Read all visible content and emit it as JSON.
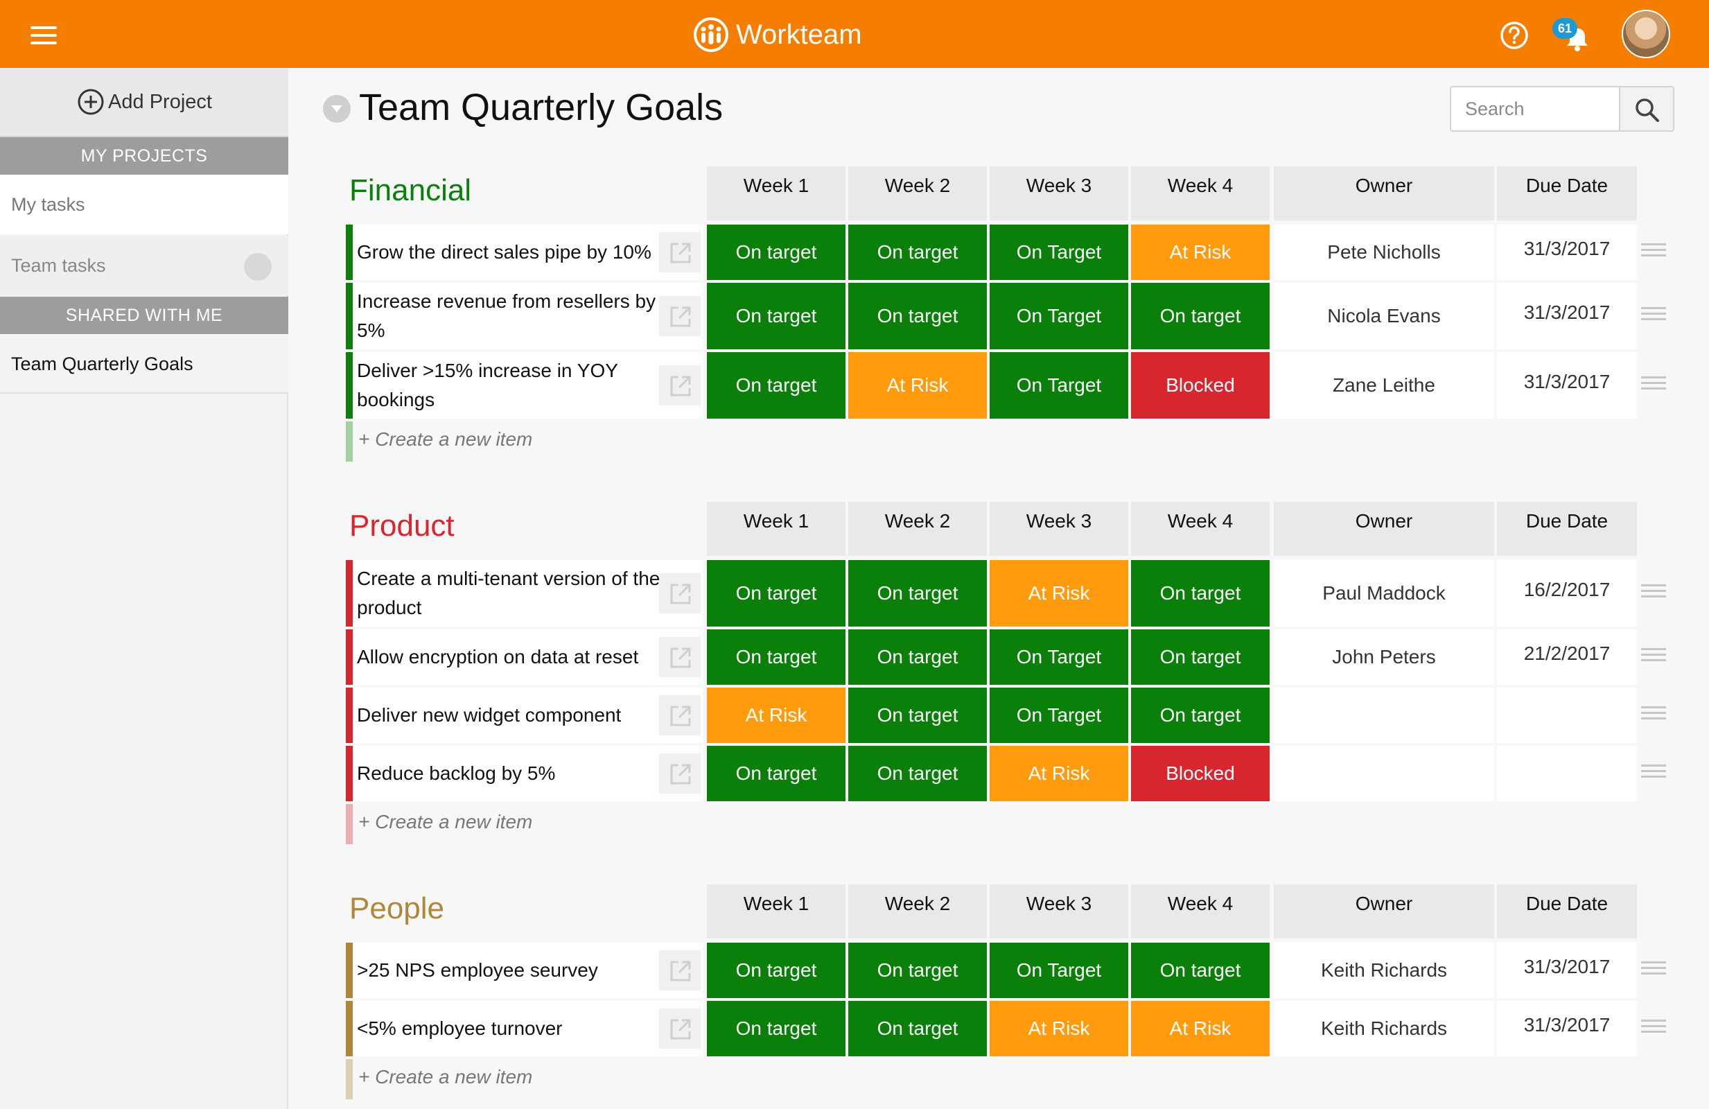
{
  "app": {
    "brand": "Workteam",
    "notifications": "61",
    "help_icon": "question-circle-icon",
    "bell_icon": "bell-icon"
  },
  "colors": {
    "accent": "#f57d00",
    "on_target": "#0a800a",
    "at_risk": "#ff9b0d",
    "blocked": "#d7262d",
    "financial": "#0a800a",
    "product": "#d7262d",
    "people": "#b0873a"
  },
  "sidebar": {
    "add_project": "Add Project",
    "my_projects": "MY PROJECTS",
    "my_tasks": "My tasks",
    "team_tasks": "Team tasks",
    "shared_with_me": "SHARED WITH ME",
    "current_project": "Team Quarterly Goals"
  },
  "page": {
    "title": "Team Quarterly Goals",
    "search_placeholder": "Search"
  },
  "columns": [
    "Week 1",
    "Week 2",
    "Week 3",
    "Week 4",
    "Owner",
    "Due Date"
  ],
  "create_item": "+ Create a new item",
  "groups": [
    {
      "name": "Financial",
      "rows": [
        {
          "task": "Grow the direct sales pipe by 10%",
          "weeks": [
            "On target",
            "On target",
            "On Target",
            "At Risk"
          ],
          "owner": "Pete Nicholls",
          "due": "31/3/2017"
        },
        {
          "task": "Increase revenue from resellers by 5%",
          "weeks": [
            "On target",
            "On target",
            "On Target",
            "On target"
          ],
          "owner": "Nicola Evans",
          "due": "31/3/2017"
        },
        {
          "task": "Deliver >15% increase in YOY bookings",
          "weeks": [
            "On target",
            "At Risk",
            "On Target",
            "Blocked"
          ],
          "owner": "Zane Leithe",
          "due": "31/3/2017"
        }
      ]
    },
    {
      "name": "Product",
      "rows": [
        {
          "task": "Create a multi-tenant version of the product",
          "weeks": [
            "On target",
            "On target",
            "At Risk",
            "On target"
          ],
          "owner": "Paul Maddock",
          "due": "16/2/2017"
        },
        {
          "task": "Allow encryption on data at reset",
          "weeks": [
            "On target",
            "On target",
            "On Target",
            "On target"
          ],
          "owner": "John Peters",
          "due": "21/2/2017"
        },
        {
          "task": "Deliver new widget component",
          "weeks": [
            "At Risk",
            "On target",
            "On Target",
            "On target"
          ],
          "owner": "",
          "due": ""
        },
        {
          "task": "Reduce backlog by 5%",
          "weeks": [
            "On target",
            "On target",
            "At Risk",
            "Blocked"
          ],
          "owner": "",
          "due": ""
        }
      ]
    },
    {
      "name": "People",
      "rows": [
        {
          "task": ">25 NPS employee seurvey",
          "weeks": [
            "On target",
            "On target",
            "On Target",
            "On target"
          ],
          "owner": "Keith Richards",
          "due": "31/3/2017"
        },
        {
          "task": "<5% employee turnover",
          "weeks": [
            "On target",
            "On target",
            "At Risk",
            "At Risk"
          ],
          "owner": "Keith Richards",
          "due": "31/3/2017"
        }
      ]
    }
  ]
}
